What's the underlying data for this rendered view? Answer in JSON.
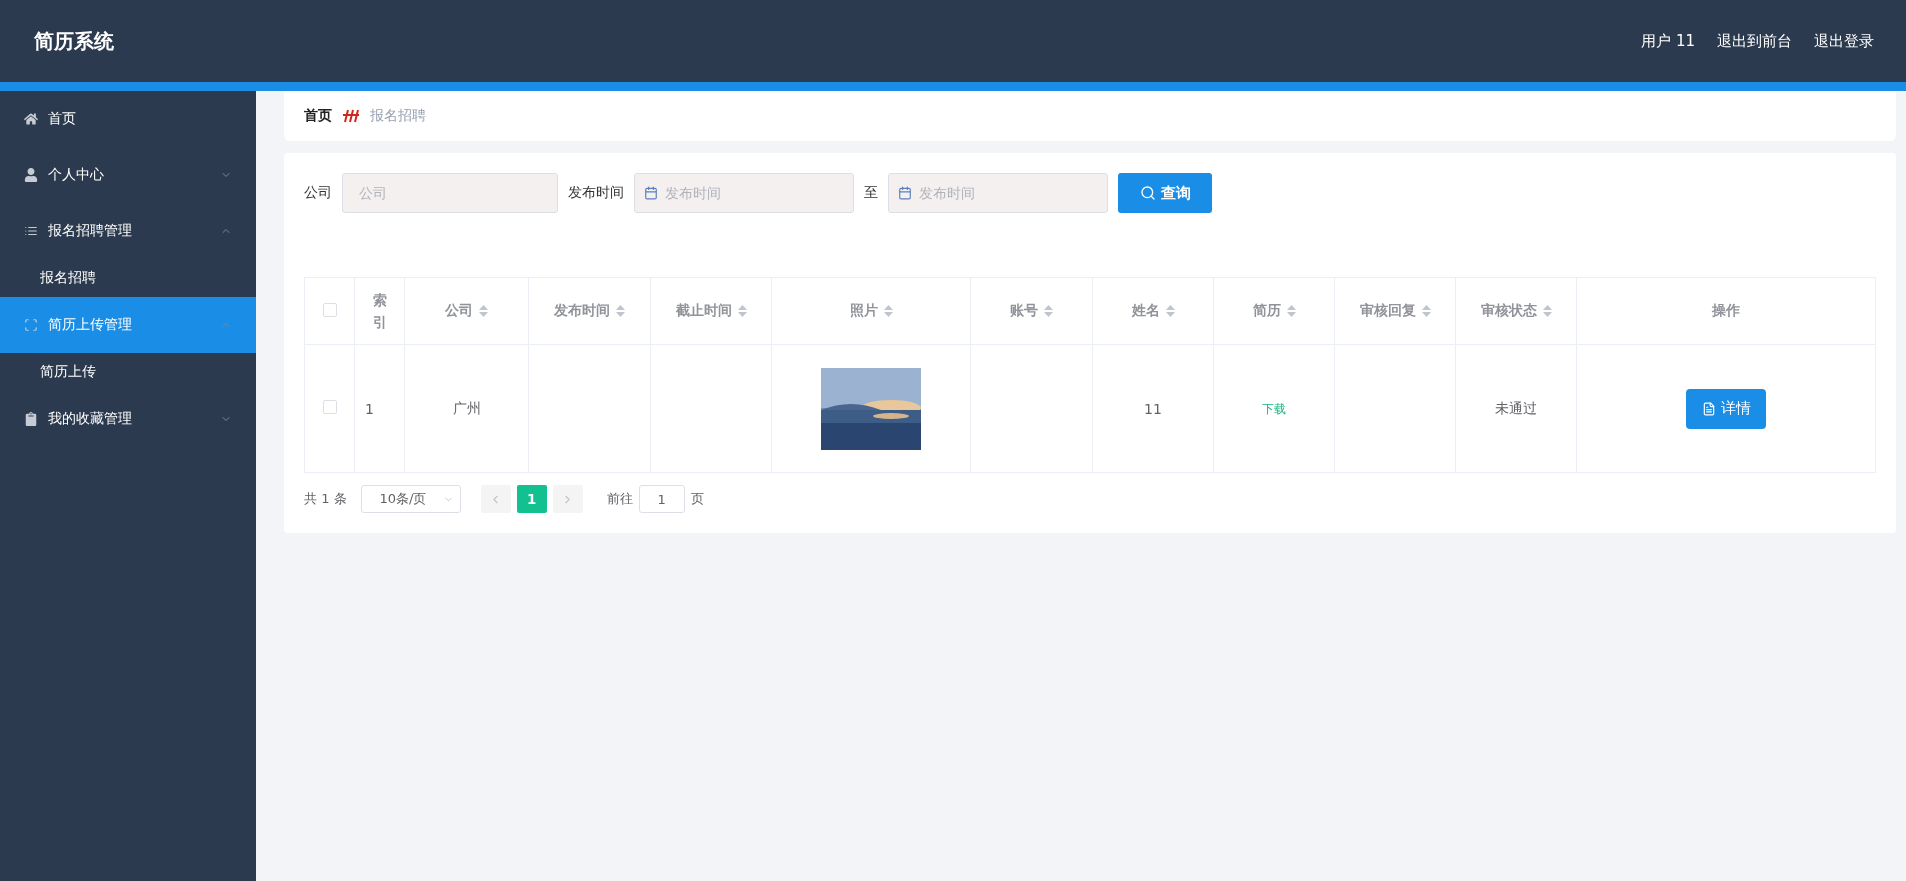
{
  "header": {
    "title": "简历系统",
    "links": [
      "用户 11",
      "退出到前台",
      "退出登录"
    ]
  },
  "sidebar": {
    "items": [
      {
        "label": "首页",
        "selected": false
      },
      {
        "label": "个人中心",
        "selected": false,
        "expanded": false
      },
      {
        "label": "报名招聘管理",
        "selected": false,
        "expanded": true,
        "children": [
          {
            "label": "报名招聘",
            "selected": false
          }
        ]
      },
      {
        "label": "简历上传管理",
        "selected": true,
        "expanded": true,
        "children": [
          {
            "label": "简历上传",
            "selected": false
          }
        ]
      },
      {
        "label": "我的收藏管理",
        "selected": false,
        "expanded": false
      }
    ]
  },
  "breadcrumb": {
    "home": "首页",
    "current": "报名招聘"
  },
  "search": {
    "company_label": "公司",
    "company_placeholder": "公司",
    "date_label": "发布时间",
    "date_from_placeholder": "发布时间",
    "range_separator": "至",
    "date_to_placeholder": "发布时间",
    "button": "查询"
  },
  "table": {
    "select_all_checked": false,
    "columns": [
      {
        "label": "索引",
        "sortable": false
      },
      {
        "label": "公司",
        "sortable": true
      },
      {
        "label": "发布时间",
        "sortable": true
      },
      {
        "label": "截止时间",
        "sortable": true
      },
      {
        "label": "照片",
        "sortable": true
      },
      {
        "label": "账号",
        "sortable": true
      },
      {
        "label": "姓名",
        "sortable": true
      },
      {
        "label": "简历",
        "sortable": true
      },
      {
        "label": "审核回复",
        "sortable": true
      },
      {
        "label": "审核状态",
        "sortable": true
      },
      {
        "label": "操作",
        "sortable": false
      }
    ],
    "rows": [
      {
        "checked": false,
        "cells": [
          {
            "kind": "text",
            "text": "1"
          },
          {
            "kind": "text",
            "text": "广州"
          },
          {
            "kind": "empty"
          },
          {
            "kind": "empty"
          },
          {
            "kind": "picture"
          },
          {
            "kind": "empty"
          },
          {
            "kind": "text",
            "text": "11"
          },
          {
            "kind": "link",
            "text": "下载"
          },
          {
            "kind": "empty"
          },
          {
            "kind": "text",
            "text": "未通过"
          },
          {
            "kind": "button",
            "text": "详情"
          }
        ]
      }
    ]
  },
  "pagination": {
    "total": "共 1 条",
    "page_size": "10条/页",
    "pages": [
      {
        "label": "1",
        "selected": true
      }
    ],
    "goto_label": "前往",
    "goto_value": "1",
    "goto_suffix": "页"
  }
}
